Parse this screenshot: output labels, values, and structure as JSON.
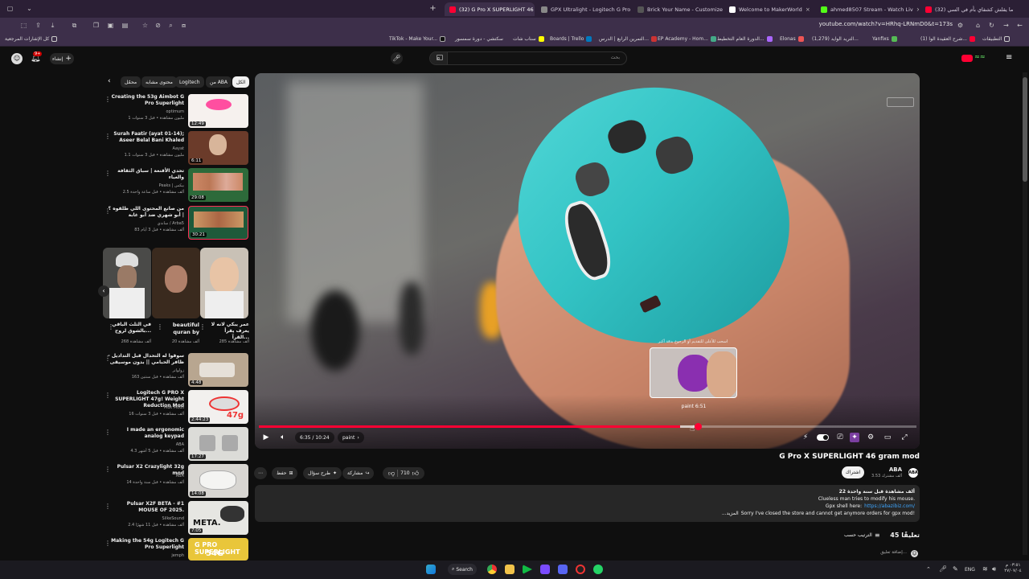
{
  "tabs": [
    {
      "label": "(32) G Pro X SUPERLIGHT 46 g",
      "active": true
    },
    {
      "label": "GPX Ultralight - Logitech G Pro"
    },
    {
      "label": "Brick Your Name - Customize"
    },
    {
      "label": "Welcome to MakerWorld"
    },
    {
      "label": "ahmed8507 Stream - Watch Liv"
    },
    {
      "label": "(32) ما يقلش كشفاي بأم في السي"
    }
  ],
  "address": {
    "url": "youtube.com/watch?v=HRhq-LRNmD0&t=173s"
  },
  "bookmarks": [
    "TikTok - Make Your...",
    "سكتشي - دورة سمسور",
    "سناب شات",
    "Boards | Trello",
    "التمرين الرابع | الدرس...",
    "EP Academy - Hom...",
    "الدورة العام التخطيط...",
    "Elonas",
    "(1,279) التريد الوايد...",
    "Yanfixs",
    "(1) شرح العقيدة الوا...",
    "التطبيقات"
  ],
  "bookmarks_right": "كل الإشارات المرجعية",
  "yt": {
    "search_placeholder": "بحث",
    "create_label": "إنشاء",
    "notif_count": "9+"
  },
  "chips": [
    "الكل",
    "من ABA",
    "Logitech",
    "محتوى مشابه",
    "محمّل"
  ],
  "sidebar": [
    {
      "title": "Creating the 53g Aimbot G Pro Superlight",
      "channel": "optimum",
      "meta": "1 مليون مشاهدة • قبل 3 سنوات",
      "duration": "12:49",
      "thumb": "#f6f1ee"
    },
    {
      "title": "Surah Faatir (ayat 01-14); Aseer Belal Bani Khaled",
      "channel": "Aayat",
      "meta": "1.1 مليون مشاهدة • قبل 3 سنوات",
      "duration": "6:11",
      "thumb": "#6b3b2a"
    },
    {
      "title": "تحدي الأقنعة | سباق الثقافة والغباء",
      "channel": "Peaks | بيكس",
      "meta": "2.5 ألف مشاهدة • قبل ساعة واحدة",
      "duration": "29:08",
      "thumb": "#2d6a3a"
    },
    {
      "title": "من صانع المحتوى اللي طلقوه ؟ | أبو شهري ضد أبو غابة",
      "channel": "ساندي / Arba5",
      "meta": "83 ألف مشاهدة • قبل 3 أيام",
      "duration": "30:21",
      "thumb": "#1e5a3a"
    }
  ],
  "shorts": [
    {
      "title": "عمر يبكي لانه لا يعرف يقرأ القرآ...",
      "views": "285 ألف مشاهدة",
      "thumb": "#c9c1b6"
    },
    {
      "title": "beautiful quran by",
      "views": "20 ألف مشاهدة",
      "thumb": "#3a2a1e"
    },
    {
      "title": "في الثلث الباقي بالشوق لروح...",
      "views": "268 ألف مشاهدة",
      "thumb": "#4a4a48"
    }
  ],
  "sidebar2": [
    {
      "title": "سوقوا له التحدال قبل التداديل - ظافر الحبامي || بدون موسيقى",
      "channel": "زولواتر",
      "meta": "163 ألف مشاهدة • قبل سنتين",
      "duration": "4:48",
      "thumb": "#b8a690"
    },
    {
      "title": "Logitech G PRO X SUPERLIGHT 47g! Weight Reduction Mod",
      "channel": "Muk Mods",
      "meta": "16 ألف مشاهدة • قبل 3 سنوات",
      "duration": "2:44:23",
      "thumb": "#f2f0ee"
    },
    {
      "title": "I made an ergonomic analog keypad",
      "channel": "ABA",
      "meta": "4.3 ألف مشاهدة • قبل 5 أشهر",
      "duration": "17:27",
      "thumb": "#dcdcd8"
    },
    {
      "title": "Pulsar X2 Crazylight 32g mod",
      "channel": "ABA",
      "meta": "14 ألف مشاهدة • قبل سنة واحدة",
      "duration": "14:08",
      "thumb": "#d8d6d2"
    },
    {
      "title": "Pulsar X2F BETA - #1 MOUSE OF 2025.",
      "channel": "SilkeSound",
      "meta": "2.4 ألف مشاهدة • قبل 11 شهرًا",
      "duration": "7:05",
      "thumb": "#e6e6e2"
    },
    {
      "title": "Making the 54g Logitech G Pro Superlight",
      "channel": "jemph",
      "meta": "",
      "duration": "",
      "thumb": "#e9c63a"
    }
  ],
  "player": {
    "time": "6:35 / 10:24",
    "chapter": "paint",
    "preview_label": "paint 6:51",
    "preview_hint": "اسحب للأعلى للتقديم أو الرجوع بدقة أكبر",
    "progress": 0.64,
    "hover": 0.667
  },
  "video": {
    "title": "G Pro X SUPERLIGHT 46 gram mod",
    "channel": "ABA",
    "subs": "3.53 ألف مشترك",
    "subscribe_label": "اشتراك",
    "likes": "710",
    "share_label": "مشاركة",
    "ask_label": "طرح سؤال",
    "save_label": "حفظ"
  },
  "description": {
    "stats": "22 ألف مشاهدة قبل سنة واحدة",
    "line1": "Clueless man tries to modify his mouse.",
    "line2_prefix": "Gpx shell here:",
    "link": "https://abazibiz.com/",
    "line3": "Sorry I've closed the store and cannot get anymore orders for gpx mod!",
    "more": "...المزيد"
  },
  "comments": {
    "count_label": "45 تعليقًا",
    "sort_label": "الترتيب حسب",
    "add_placeholder": "إضافة تعليق..."
  },
  "taskbar": {
    "search": "Search",
    "lang": "ENG",
    "time": "٠٣:٥١ م",
    "date": "٢٧/٠٧/٠٤"
  }
}
